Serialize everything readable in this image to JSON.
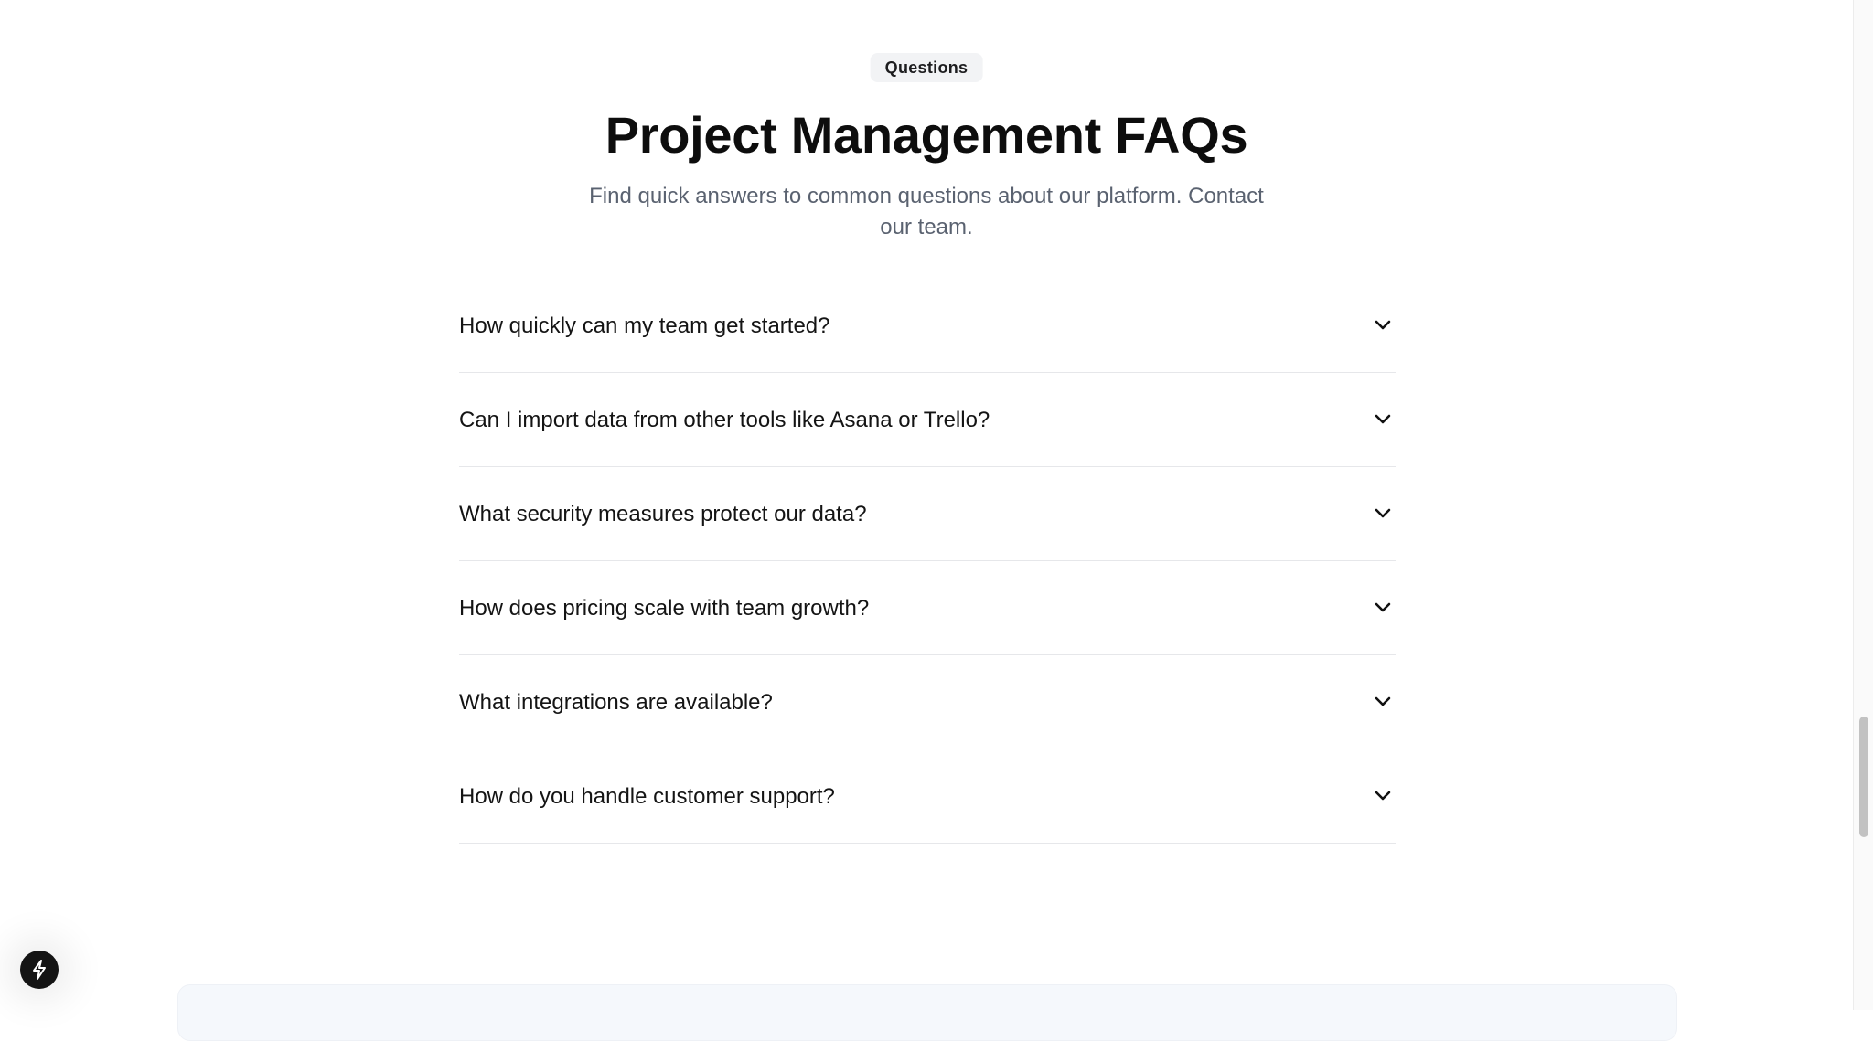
{
  "header": {
    "badge": "Questions",
    "title": "Project Management FAQs",
    "subtitle": "Find quick answers to common questions about our platform. Contact our team."
  },
  "faqs": [
    {
      "question": "How quickly can my team get started?",
      "icon": "chevron-down-icon"
    },
    {
      "question": "Can I import data from other tools like Asana or Trello?",
      "icon": "chevron-down-icon"
    },
    {
      "question": "What security measures protect our data?",
      "icon": "chevron-down-icon"
    },
    {
      "question": "How does pricing scale with team growth?",
      "icon": "chevron-down-icon"
    },
    {
      "question": "What integrations are available?",
      "icon": "chevron-down-icon"
    },
    {
      "question": "How do you handle customer support?",
      "icon": "chevron-down-icon"
    }
  ],
  "floating_button": {
    "icon": "lightning-bolt-icon"
  },
  "colors": {
    "background": "#ffffff",
    "badge_bg": "#f2f3f5",
    "title": "#0d0d0d",
    "subtitle": "#5a6270",
    "divider": "#e6e7ea",
    "fab": "#141414"
  }
}
